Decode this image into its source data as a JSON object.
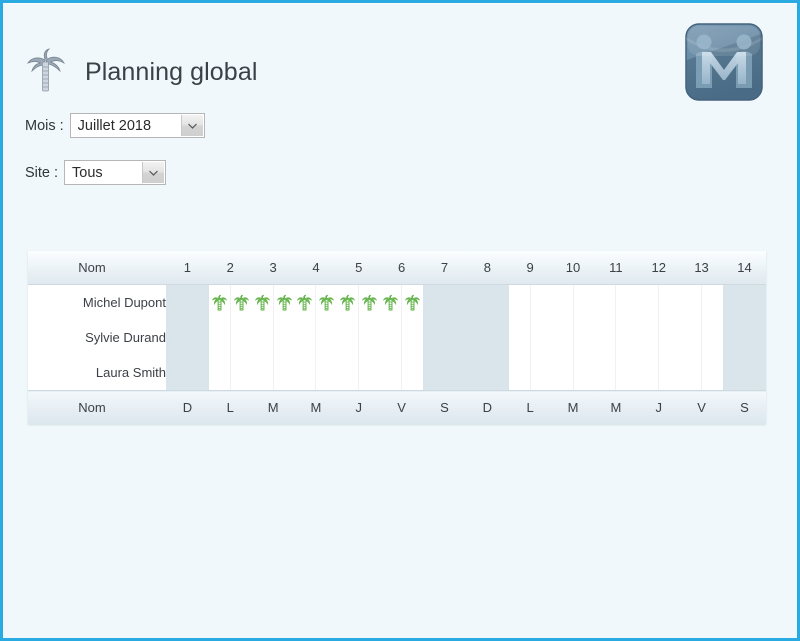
{
  "window": {
    "background_color": "#f0f8fb",
    "border_color": "#29abe2"
  },
  "header": {
    "title": "Planning global",
    "title_icon": "palm-tree-icon",
    "logo_icon": "app-logo-m-icon"
  },
  "filters": [
    {
      "id": "mois",
      "label": "Mois :",
      "name": "month-select",
      "value": "Juillet 2018",
      "options": [
        "Juillet 2018"
      ]
    },
    {
      "id": "site",
      "label": "Site :",
      "name": "site-select",
      "value": "Tous",
      "options": [
        "Tous"
      ]
    }
  ],
  "planning": {
    "name_column_header": "Nom",
    "name_column_footer": "Nom",
    "days": [
      1,
      2,
      3,
      4,
      5,
      6,
      7,
      8,
      9,
      10,
      11,
      12,
      13,
      14
    ],
    "day_letters": [
      "D",
      "L",
      "M",
      "M",
      "J",
      "V",
      "S",
      "D",
      "L",
      "M",
      "M",
      "J",
      "V",
      "S"
    ],
    "weekend_days": [
      1,
      7,
      8,
      14
    ],
    "leave_icon": "palm-tree-icon",
    "leave_icon_color": "#63b34a",
    "employees": [
      {
        "name": "Michel Dupont",
        "half_days": {
          "1": [
            false,
            false
          ],
          "2": [
            true,
            true
          ],
          "3": [
            true,
            true
          ],
          "4": [
            true,
            true
          ],
          "5": [
            true,
            true
          ],
          "6": [
            true,
            true
          ],
          "7": [
            false,
            false
          ],
          "8": [
            false,
            false
          ],
          "9": [
            false,
            false
          ],
          "10": [
            false,
            false
          ],
          "11": [
            false,
            false
          ],
          "12": [
            false,
            false
          ],
          "13": [
            false,
            false
          ],
          "14": [
            false,
            false
          ]
        }
      },
      {
        "name": "Sylvie Durand",
        "half_days": {
          "1": [
            false,
            false
          ],
          "2": [
            false,
            false
          ],
          "3": [
            false,
            false
          ],
          "4": [
            false,
            false
          ],
          "5": [
            false,
            false
          ],
          "6": [
            false,
            false
          ],
          "7": [
            false,
            false
          ],
          "8": [
            false,
            false
          ],
          "9": [
            false,
            false
          ],
          "10": [
            false,
            false
          ],
          "11": [
            false,
            false
          ],
          "12": [
            false,
            false
          ],
          "13": [
            false,
            false
          ],
          "14": [
            false,
            false
          ]
        }
      },
      {
        "name": "Laura Smith",
        "half_days": {
          "1": [
            false,
            false
          ],
          "2": [
            false,
            false
          ],
          "3": [
            false,
            false
          ],
          "4": [
            false,
            false
          ],
          "5": [
            false,
            false
          ],
          "6": [
            false,
            false
          ],
          "7": [
            false,
            false
          ],
          "8": [
            false,
            false
          ],
          "9": [
            false,
            false
          ],
          "10": [
            false,
            false
          ],
          "11": [
            false,
            false
          ],
          "12": [
            false,
            false
          ],
          "13": [
            false,
            false
          ],
          "14": [
            false,
            false
          ]
        }
      }
    ]
  }
}
